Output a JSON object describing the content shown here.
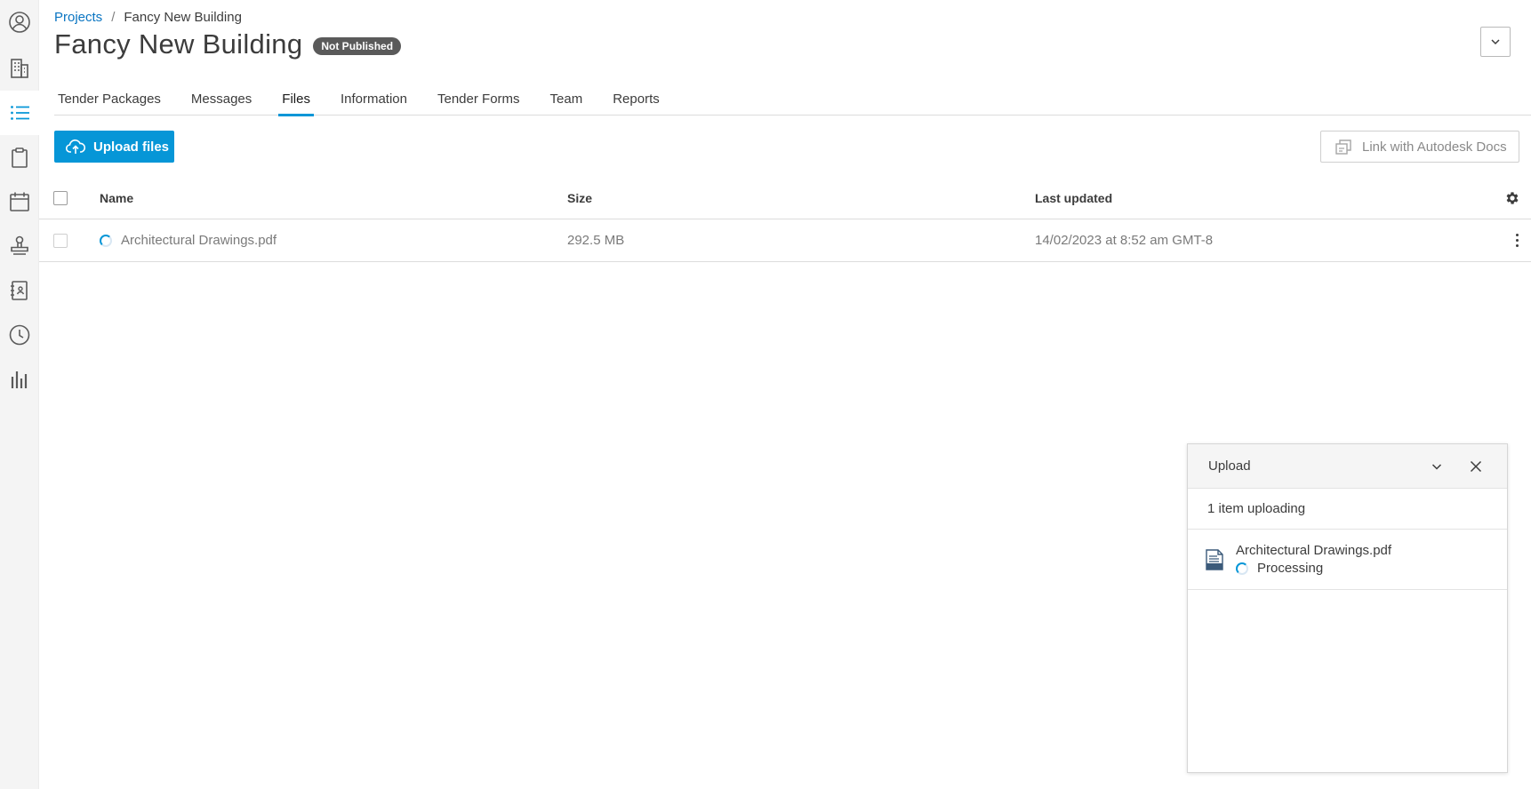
{
  "nav": {
    "items": [
      {
        "icon": "user-circle-icon"
      },
      {
        "icon": "building-icon"
      },
      {
        "icon": "list-icon",
        "active": true
      },
      {
        "icon": "clipboard-icon"
      },
      {
        "icon": "calendar-icon"
      },
      {
        "icon": "stamp-icon"
      },
      {
        "icon": "address-book-icon"
      },
      {
        "icon": "clock-icon"
      },
      {
        "icon": "bar-chart-icon"
      }
    ]
  },
  "breadcrumb": {
    "root": "Projects",
    "separator": "/",
    "current": "Fancy New Building"
  },
  "header": {
    "title": "Fancy New Building",
    "badge": "Not Published"
  },
  "tabs": [
    {
      "label": "Tender Packages"
    },
    {
      "label": "Messages"
    },
    {
      "label": "Files",
      "active": true
    },
    {
      "label": "Information"
    },
    {
      "label": "Tender Forms"
    },
    {
      "label": "Team"
    },
    {
      "label": "Reports"
    }
  ],
  "toolbar": {
    "upload_label": "Upload files",
    "link_label": "Link with Autodesk Docs"
  },
  "table": {
    "columns": {
      "name": "Name",
      "size": "Size",
      "updated": "Last updated"
    },
    "rows": [
      {
        "name": "Architectural Drawings.pdf",
        "size": "292.5 MB",
        "updated": "14/02/2023 at 8:52 am GMT-8"
      }
    ]
  },
  "upload_panel": {
    "title": "Upload",
    "status": "1 item uploading",
    "items": [
      {
        "name": "Architectural Drawings.pdf",
        "state": "Processing"
      }
    ]
  },
  "colors": {
    "accent": "#0696d7",
    "link": "#0a75c2",
    "badge_bg": "#5a5a5a"
  }
}
